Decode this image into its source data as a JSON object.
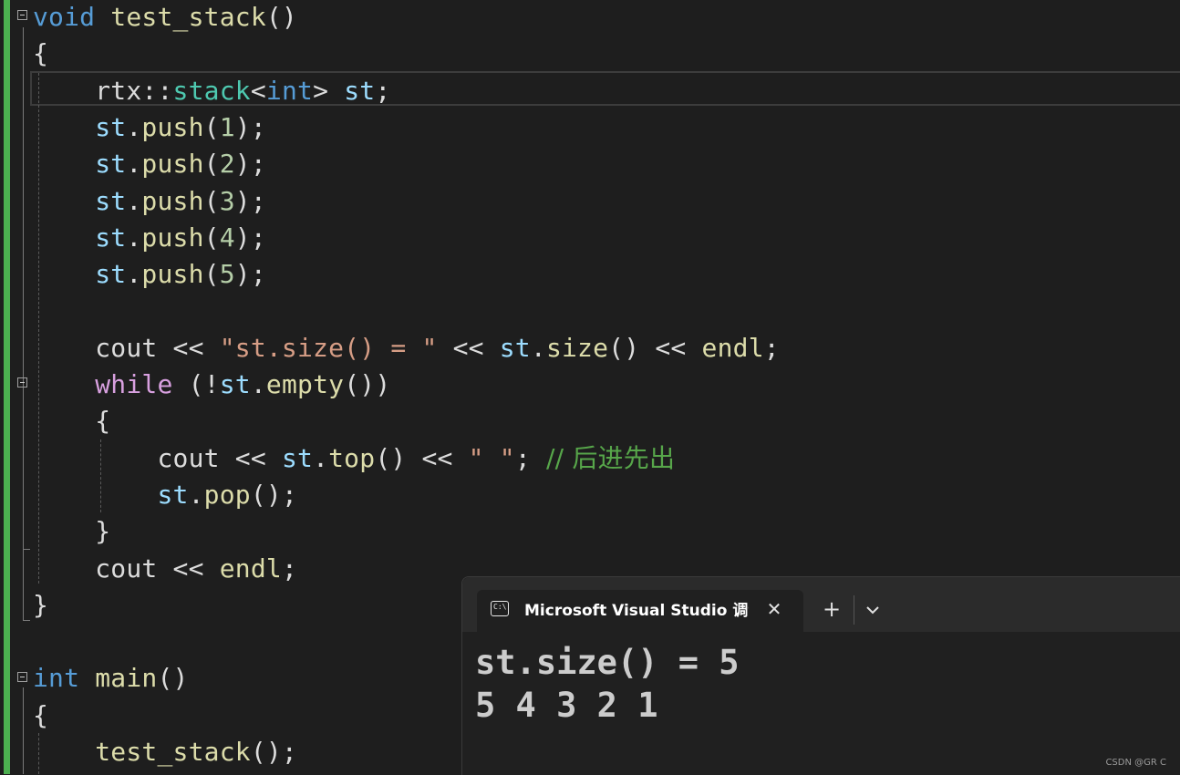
{
  "editor": {
    "lines": [
      [
        [
          "kw",
          "void"
        ],
        [
          "pl",
          " "
        ],
        [
          "fn",
          "test_stack"
        ],
        [
          "pl",
          "()"
        ]
      ],
      [
        [
          "pl",
          "{"
        ]
      ],
      [
        [
          "pl",
          "    "
        ],
        [
          "pl",
          "rtx::"
        ],
        [
          "typ",
          "stack"
        ],
        [
          "pl",
          "<"
        ],
        [
          "kw",
          "int"
        ],
        [
          "pl",
          "> "
        ],
        [
          "var",
          "st"
        ],
        [
          "pl",
          ";"
        ]
      ],
      [
        [
          "pl",
          "    "
        ],
        [
          "var",
          "st"
        ],
        [
          "pl",
          "."
        ],
        [
          "fn",
          "push"
        ],
        [
          "pl",
          "("
        ],
        [
          "num",
          "1"
        ],
        [
          "pl",
          ");"
        ]
      ],
      [
        [
          "pl",
          "    "
        ],
        [
          "var",
          "st"
        ],
        [
          "pl",
          "."
        ],
        [
          "fn",
          "push"
        ],
        [
          "pl",
          "("
        ],
        [
          "num",
          "2"
        ],
        [
          "pl",
          ");"
        ]
      ],
      [
        [
          "pl",
          "    "
        ],
        [
          "var",
          "st"
        ],
        [
          "pl",
          "."
        ],
        [
          "fn",
          "push"
        ],
        [
          "pl",
          "("
        ],
        [
          "num",
          "3"
        ],
        [
          "pl",
          ");"
        ]
      ],
      [
        [
          "pl",
          "    "
        ],
        [
          "var",
          "st"
        ],
        [
          "pl",
          "."
        ],
        [
          "fn",
          "push"
        ],
        [
          "pl",
          "("
        ],
        [
          "num",
          "4"
        ],
        [
          "pl",
          ");"
        ]
      ],
      [
        [
          "pl",
          "    "
        ],
        [
          "var",
          "st"
        ],
        [
          "pl",
          "."
        ],
        [
          "fn",
          "push"
        ],
        [
          "pl",
          "("
        ],
        [
          "num",
          "5"
        ],
        [
          "pl",
          ");"
        ]
      ],
      [
        [
          "pl",
          ""
        ]
      ],
      [
        [
          "pl",
          "    "
        ],
        [
          "pl",
          "cout << "
        ],
        [
          "str",
          "\"st.size() = \""
        ],
        [
          "pl",
          " << "
        ],
        [
          "var",
          "st"
        ],
        [
          "pl",
          "."
        ],
        [
          "fn",
          "size"
        ],
        [
          "pl",
          "() << "
        ],
        [
          "fn",
          "endl"
        ],
        [
          "pl",
          ";"
        ]
      ],
      [
        [
          "pl",
          "    "
        ],
        [
          "ctl",
          "while"
        ],
        [
          "pl",
          " (!"
        ],
        [
          "var",
          "st"
        ],
        [
          "pl",
          "."
        ],
        [
          "fn",
          "empty"
        ],
        [
          "pl",
          "())"
        ]
      ],
      [
        [
          "pl",
          "    "
        ],
        [
          "pl",
          "{"
        ]
      ],
      [
        [
          "pl",
          "        "
        ],
        [
          "pl",
          "cout << "
        ],
        [
          "var",
          "st"
        ],
        [
          "pl",
          "."
        ],
        [
          "fn",
          "top"
        ],
        [
          "pl",
          "() << "
        ],
        [
          "str",
          "\" \""
        ],
        [
          "pl",
          "; "
        ],
        [
          "cmt",
          "// 后进先出"
        ]
      ],
      [
        [
          "pl",
          "        "
        ],
        [
          "var",
          "st"
        ],
        [
          "pl",
          "."
        ],
        [
          "fn",
          "pop"
        ],
        [
          "pl",
          "();"
        ]
      ],
      [
        [
          "pl",
          "    "
        ],
        [
          "pl",
          "}"
        ]
      ],
      [
        [
          "pl",
          "    "
        ],
        [
          "pl",
          "cout << "
        ],
        [
          "fn",
          "endl"
        ],
        [
          "pl",
          ";"
        ]
      ],
      [
        [
          "pl",
          "}"
        ]
      ],
      [
        [
          "pl",
          ""
        ]
      ],
      [
        [
          "kw",
          "int"
        ],
        [
          "pl",
          " "
        ],
        [
          "fn",
          "main"
        ],
        [
          "pl",
          "()"
        ]
      ],
      [
        [
          "pl",
          "{"
        ]
      ],
      [
        [
          "pl",
          "    "
        ],
        [
          "fn",
          "test_stack"
        ],
        [
          "pl",
          "();"
        ]
      ]
    ]
  },
  "console": {
    "tab_title": "Microsoft Visual Studio 调试控制台",
    "tab_icon_text": "C:\\",
    "close_glyph": "✕",
    "new_tab_glyph": "+",
    "output": [
      "st.size() = 5",
      "5 4 3 2 1"
    ]
  },
  "watermark": "CSDN @GR C"
}
